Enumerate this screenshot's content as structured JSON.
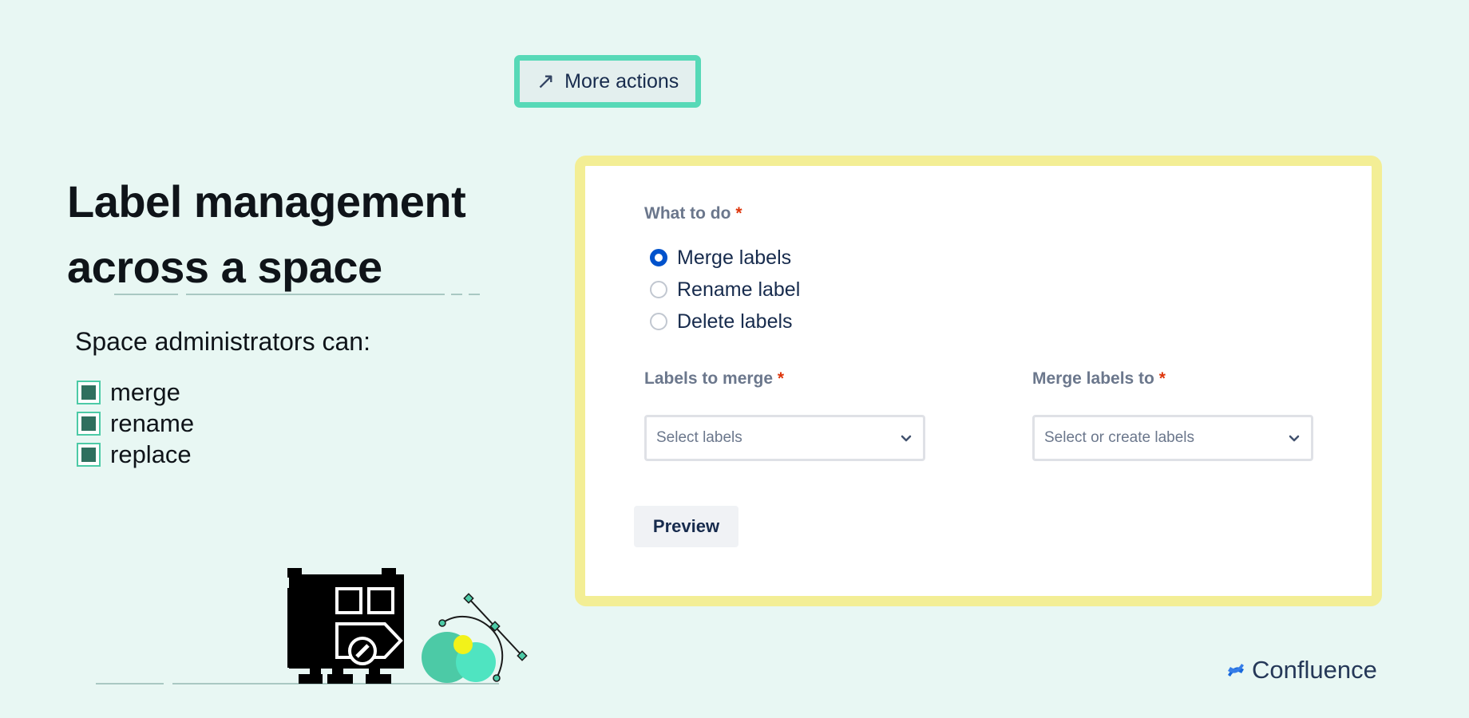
{
  "toolbar": {
    "more_actions_label": "More actions"
  },
  "hero": {
    "title_line1": "Label management",
    "title_line2": "across a space",
    "subtitle": "Space administrators can:",
    "capabilities": [
      "merge",
      "rename",
      "replace"
    ]
  },
  "form": {
    "what_to_do_label": "What to do",
    "required_mark": "*",
    "options": [
      {
        "label": "Merge labels",
        "selected": true
      },
      {
        "label": "Rename label",
        "selected": false
      },
      {
        "label": "Delete labels",
        "selected": false
      }
    ],
    "labels_to_merge": {
      "label": "Labels to merge",
      "placeholder": "Select labels"
    },
    "merge_labels_to": {
      "label": "Merge labels to",
      "placeholder": "Select or create labels"
    },
    "preview_label": "Preview"
  },
  "brand": {
    "name": "Confluence"
  },
  "colors": {
    "background": "#e8f7f3",
    "accent_teal": "#57d9b7",
    "card_border": "#f3ee95",
    "radio_selected": "#0052cc",
    "required": "#de350b"
  }
}
